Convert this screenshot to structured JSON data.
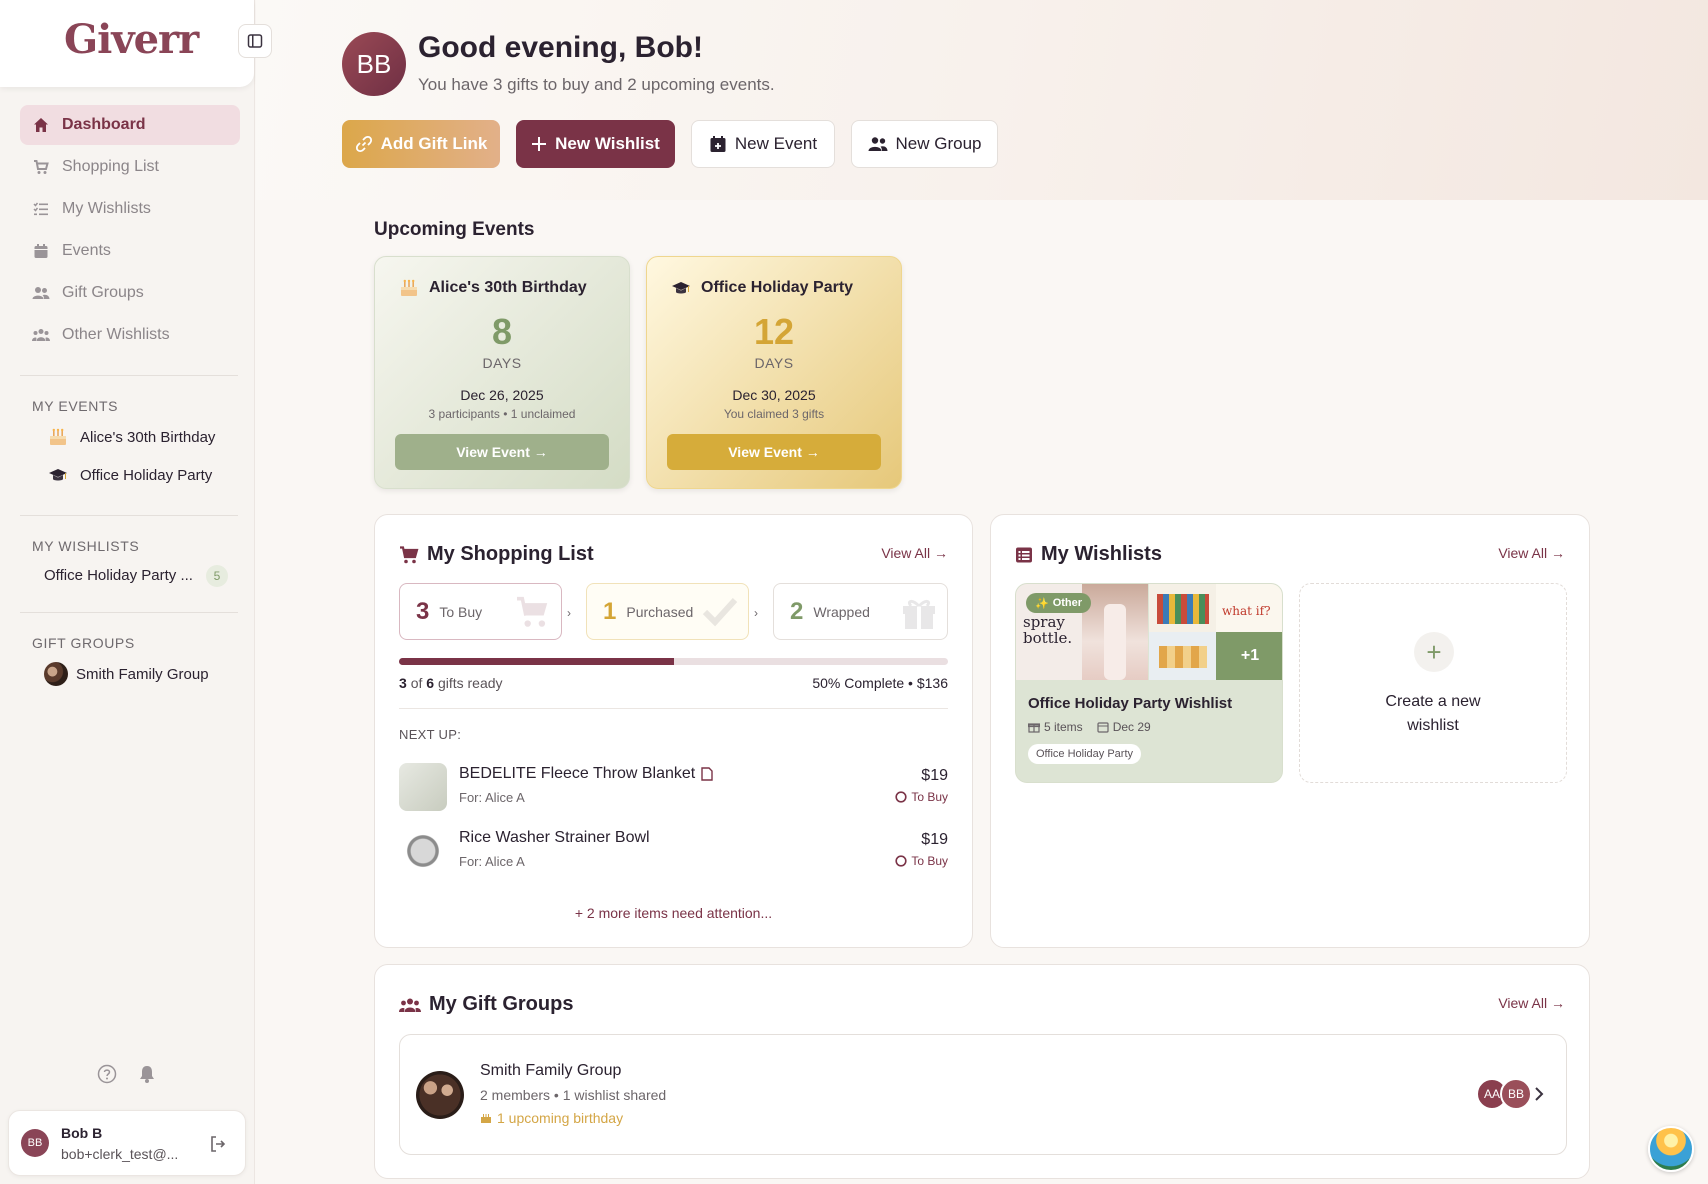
{
  "app": {
    "name": "Giverr"
  },
  "sidebar": {
    "nav": [
      {
        "label": "Dashboard",
        "icon": "home-icon",
        "active": true
      },
      {
        "label": "Shopping List",
        "icon": "cart-icon"
      },
      {
        "label": "My Wishlists",
        "icon": "list-icon"
      },
      {
        "label": "Events",
        "icon": "calendar-icon"
      },
      {
        "label": "Gift Groups",
        "icon": "users-icon"
      },
      {
        "label": "Other Wishlists",
        "icon": "group-icon"
      }
    ],
    "my_events": {
      "heading": "MY EVENTS",
      "items": [
        {
          "label": "Alice's 30th Birthday",
          "icon": "cake-icon"
        },
        {
          "label": "Office Holiday Party",
          "icon": "graduation-cap-icon"
        }
      ]
    },
    "my_wishlists": {
      "heading": "MY WISHLISTS",
      "items": [
        {
          "label": "Office Holiday Party ...",
          "count": "5"
        }
      ]
    },
    "gift_groups": {
      "heading": "GIFT GROUPS",
      "items": [
        {
          "label": "Smith Family Group"
        }
      ]
    },
    "user": {
      "initials": "BB",
      "name": "Bob B",
      "email": "bob+clerk_test@..."
    }
  },
  "header": {
    "initials": "BB",
    "greeting": "Good evening, Bob!",
    "subtitle": "You have 3 gifts to buy and 2 upcoming events.",
    "buttons": {
      "add_gift_link": "Add Gift Link",
      "new_wishlist": "New Wishlist",
      "new_event": "New Event",
      "new_group": "New Group"
    }
  },
  "upcoming_events": {
    "title": "Upcoming Events",
    "cards": [
      {
        "title": "Alice's 30th Birthday",
        "days": "8",
        "days_label": "DAYS",
        "date": "Dec 26, 2025",
        "note": "3 participants • 1 unclaimed",
        "button": "View Event →",
        "accent": "#7f9a68",
        "button_color": "#9fb08b"
      },
      {
        "title": "Office Holiday Party",
        "days": "12",
        "days_label": "DAYS",
        "date": "Dec 30, 2025",
        "note": "You claimed 3 gifts",
        "button": "View Event →",
        "accent": "#d4a536",
        "button_color": "#d6ac3a"
      }
    ]
  },
  "shopping": {
    "title": "My Shopping List",
    "view_all": "View All →",
    "stats": [
      {
        "count": "3",
        "label": "To Buy",
        "color": "#7a3347"
      },
      {
        "count": "1",
        "label": "Purchased",
        "color": "#d4a536"
      },
      {
        "count": "2",
        "label": "Wrapped",
        "color": "#7f9a68"
      }
    ],
    "progress_fraction": 0.5,
    "ready_count": "3",
    "ready_total": "6",
    "ready_text": "gifts ready",
    "ready_of": "of",
    "complete_text": "50% Complete • $136",
    "next_up": "NEXT UP:",
    "items": [
      {
        "name": "BEDELITE Fleece Throw Blanket",
        "for": "For: Alice A",
        "price": "$19",
        "status": "To Buy"
      },
      {
        "name": "Rice Washer Strainer Bowl",
        "for": "For: Alice A",
        "price": "$19",
        "status": "To Buy"
      }
    ],
    "more": "+ 2 more items need attention..."
  },
  "wishlists": {
    "title": "My Wishlists",
    "view_all": "View All →",
    "card": {
      "badge": "Other",
      "title": "Office Holiday Party Wishlist",
      "items": "5 items",
      "date": "Dec 29",
      "tag": "Office Holiday Party",
      "extra": "+1",
      "thumb_spray": "spray bottle.",
      "thumb_whatif": "what if?"
    },
    "create": {
      "line1": "Create a new",
      "line2": "wishlist"
    }
  },
  "gift_groups": {
    "title": "My Gift Groups",
    "view_all": "View All →",
    "group": {
      "name": "Smith Family Group",
      "meta": "2 members • 1 wishlist shared",
      "birthday": "1 upcoming birthday",
      "members": [
        {
          "initials": "AA",
          "color": "#8a3e4e"
        },
        {
          "initials": "BB",
          "color": "#9a4f5a"
        }
      ]
    }
  }
}
